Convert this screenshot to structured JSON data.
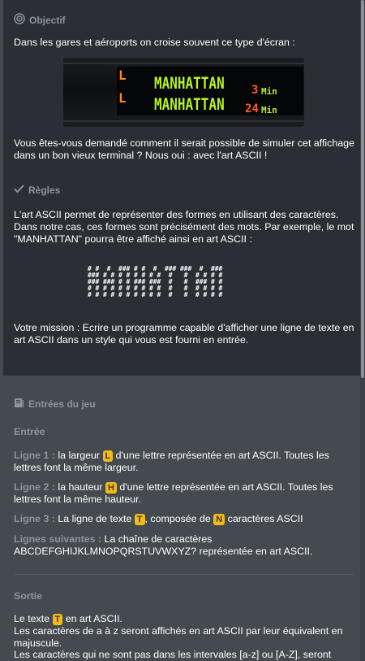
{
  "objective": {
    "title": "Objectif",
    "intro": "Dans les gares et aéroports on croise souvent ce type d'écran :",
    "banner_rows": [
      {
        "platform": "L",
        "destination": "MANHATTAN",
        "minutes": "3",
        "unit": "Min"
      },
      {
        "platform": "L",
        "destination": "MANHATTAN",
        "minutes": "24",
        "unit": "Min"
      }
    ],
    "outro": "Vous êtes-vous demandé comment il serait possible de simuler cet affichage dans un bon vieux terminal ? Nous oui : avec l'art ASCII !"
  },
  "rules": {
    "title": "Règles",
    "p1": "L'art ASCII permet de représenter des formes en utilisant des caractères. Dans notre cas, ces formes sont précisément des mots. Par exemple, le mot \"MANHATTAN\" pourra être affiché ainsi en art ASCII :",
    "ascii": "# #  #  ### # #  #  ### ###  #  ###\n### # # # # # # # #  #   #  # # # #\n### ### # # ### ###  #   #  ### # #\n# # # # # # # # # #  #   #  # # # #\n# # # # # # # # # #  #   #  # # # #",
    "p2": "Votre mission : Ecrire un programme capable d'afficher une ligne de texte en art ASCII dans un style qui vous est fourni en entrée."
  },
  "inputs": {
    "title": "Entrées du jeu",
    "entry_title": "Entrée",
    "line1_label": "Ligne 1 :",
    "line1_pre": " la largeur ",
    "line1_badge": "L",
    "line1_post": " d'une lettre représentée en art ASCII. Toutes les lettres font la même largeur.",
    "line2_label": "Ligne 2 :",
    "line2_pre": " la hauteur ",
    "line2_badge": "H",
    "line2_post": " d'une lettre représentée en art ASCII. Toutes les lettres font la même hauteur.",
    "line3_label": "Ligne 3 :",
    "line3_pre": " La ligne de texte ",
    "line3_badge": "T",
    "line3_mid": ", composée de ",
    "line3_badge2": "N",
    "line3_post": " caractères ASCII",
    "next_label": "Lignes suivantes :",
    "next_text": " La chaîne de caractères ABCDEFGHIJKLMNOPQRSTUVWXYZ? représentée en art ASCII.",
    "output_title": "Sortie",
    "out_pre": "Le texte ",
    "out_badge": "T",
    "out_post": " en art ASCII.",
    "out_l2": "Les caractères de a à z seront affichés en art ASCII par leur équivalent en majuscule.",
    "out_l3": "Les caractères qui ne sont pas dans les intervales [a-z] ou [A-Z], seront"
  }
}
